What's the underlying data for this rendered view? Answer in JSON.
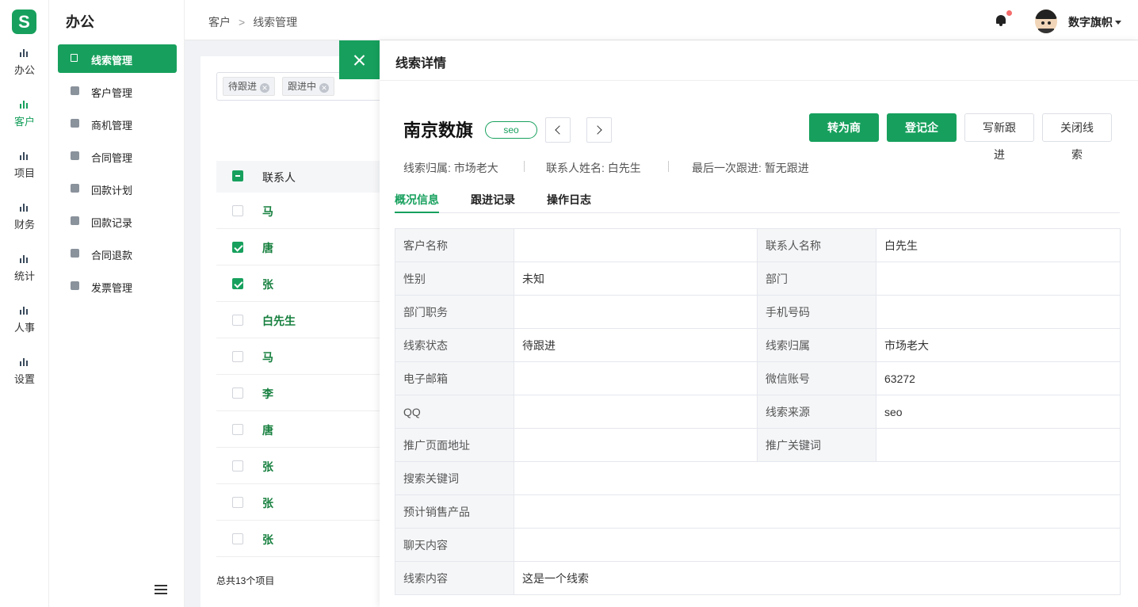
{
  "brand": {
    "logo_letter": "S",
    "accent": "#17a05d"
  },
  "rail": [
    {
      "label": "办公",
      "icon": "bar-chart-icon",
      "active": false
    },
    {
      "label": "客户",
      "icon": "bar-chart-icon",
      "active": true
    },
    {
      "label": "项目",
      "icon": "bar-chart-icon",
      "active": false
    },
    {
      "label": "财务",
      "icon": "bar-chart-icon",
      "active": false
    },
    {
      "label": "统计",
      "icon": "bar-chart-icon",
      "active": false
    },
    {
      "label": "人事",
      "icon": "bar-chart-icon",
      "active": false
    },
    {
      "label": "设置",
      "icon": "bar-chart-icon",
      "active": false
    }
  ],
  "subnav": {
    "title": "办公",
    "items": [
      {
        "label": "线索管理",
        "active": true
      },
      {
        "label": "客户管理",
        "active": false
      },
      {
        "label": "商机管理",
        "active": false
      },
      {
        "label": "合同管理",
        "active": false
      },
      {
        "label": "回款计划",
        "active": false
      },
      {
        "label": "回款记录",
        "active": false
      },
      {
        "label": "合同退款",
        "active": false
      },
      {
        "label": "发票管理",
        "active": false
      }
    ]
  },
  "header": {
    "breadcrumb": [
      "客户",
      "线索管理"
    ],
    "user_name": "数字旗帜",
    "notification_dot": "#f56c6c"
  },
  "list": {
    "filter_tags": [
      "待跟进",
      "跟进中"
    ],
    "column_header": "联系人",
    "rows": [
      {
        "name": "马",
        "checked": false
      },
      {
        "name": "唐",
        "checked": true
      },
      {
        "name": "张",
        "checked": true
      },
      {
        "name": "白先生",
        "checked": false
      },
      {
        "name": "马",
        "checked": false
      },
      {
        "name": "李",
        "checked": false
      },
      {
        "name": "唐",
        "checked": false
      },
      {
        "name": "张",
        "checked": false
      },
      {
        "name": "张",
        "checked": false
      },
      {
        "name": "张",
        "checked": false
      }
    ],
    "total_text": "总共13个项目"
  },
  "drawer": {
    "title": "线索详情",
    "company": "南京数旗",
    "source_tag": "seo",
    "actions": {
      "convert": "转为商机",
      "register": "登记企业",
      "new_followup": "写新跟进",
      "close_lead": "关闭线索"
    },
    "meta": [
      "线索归属: 市场老大",
      "联系人姓名: 白先生",
      "最后一次跟进: 暂无跟进"
    ],
    "tabs": [
      "概况信息",
      "跟进记录",
      "操作日志"
    ],
    "details": [
      [
        "客户名称",
        "",
        "联系人名称",
        "白先生"
      ],
      [
        "性别",
        "未知",
        "部门",
        ""
      ],
      [
        "部门职务",
        "",
        "手机号码",
        ""
      ],
      [
        "线索状态",
        "待跟进",
        "线索归属",
        "市场老大"
      ],
      [
        "电子邮箱",
        "",
        "微信账号",
        "63272"
      ],
      [
        "QQ",
        "",
        "线索来源",
        "seo"
      ],
      [
        "推广页面地址",
        "",
        "推广关键词",
        ""
      ]
    ],
    "details_wide": [
      [
        "搜索关键词",
        ""
      ],
      [
        "预计销售产品",
        ""
      ],
      [
        "聊天内容",
        ""
      ],
      [
        "线索内容",
        "这是一个线索"
      ]
    ]
  }
}
